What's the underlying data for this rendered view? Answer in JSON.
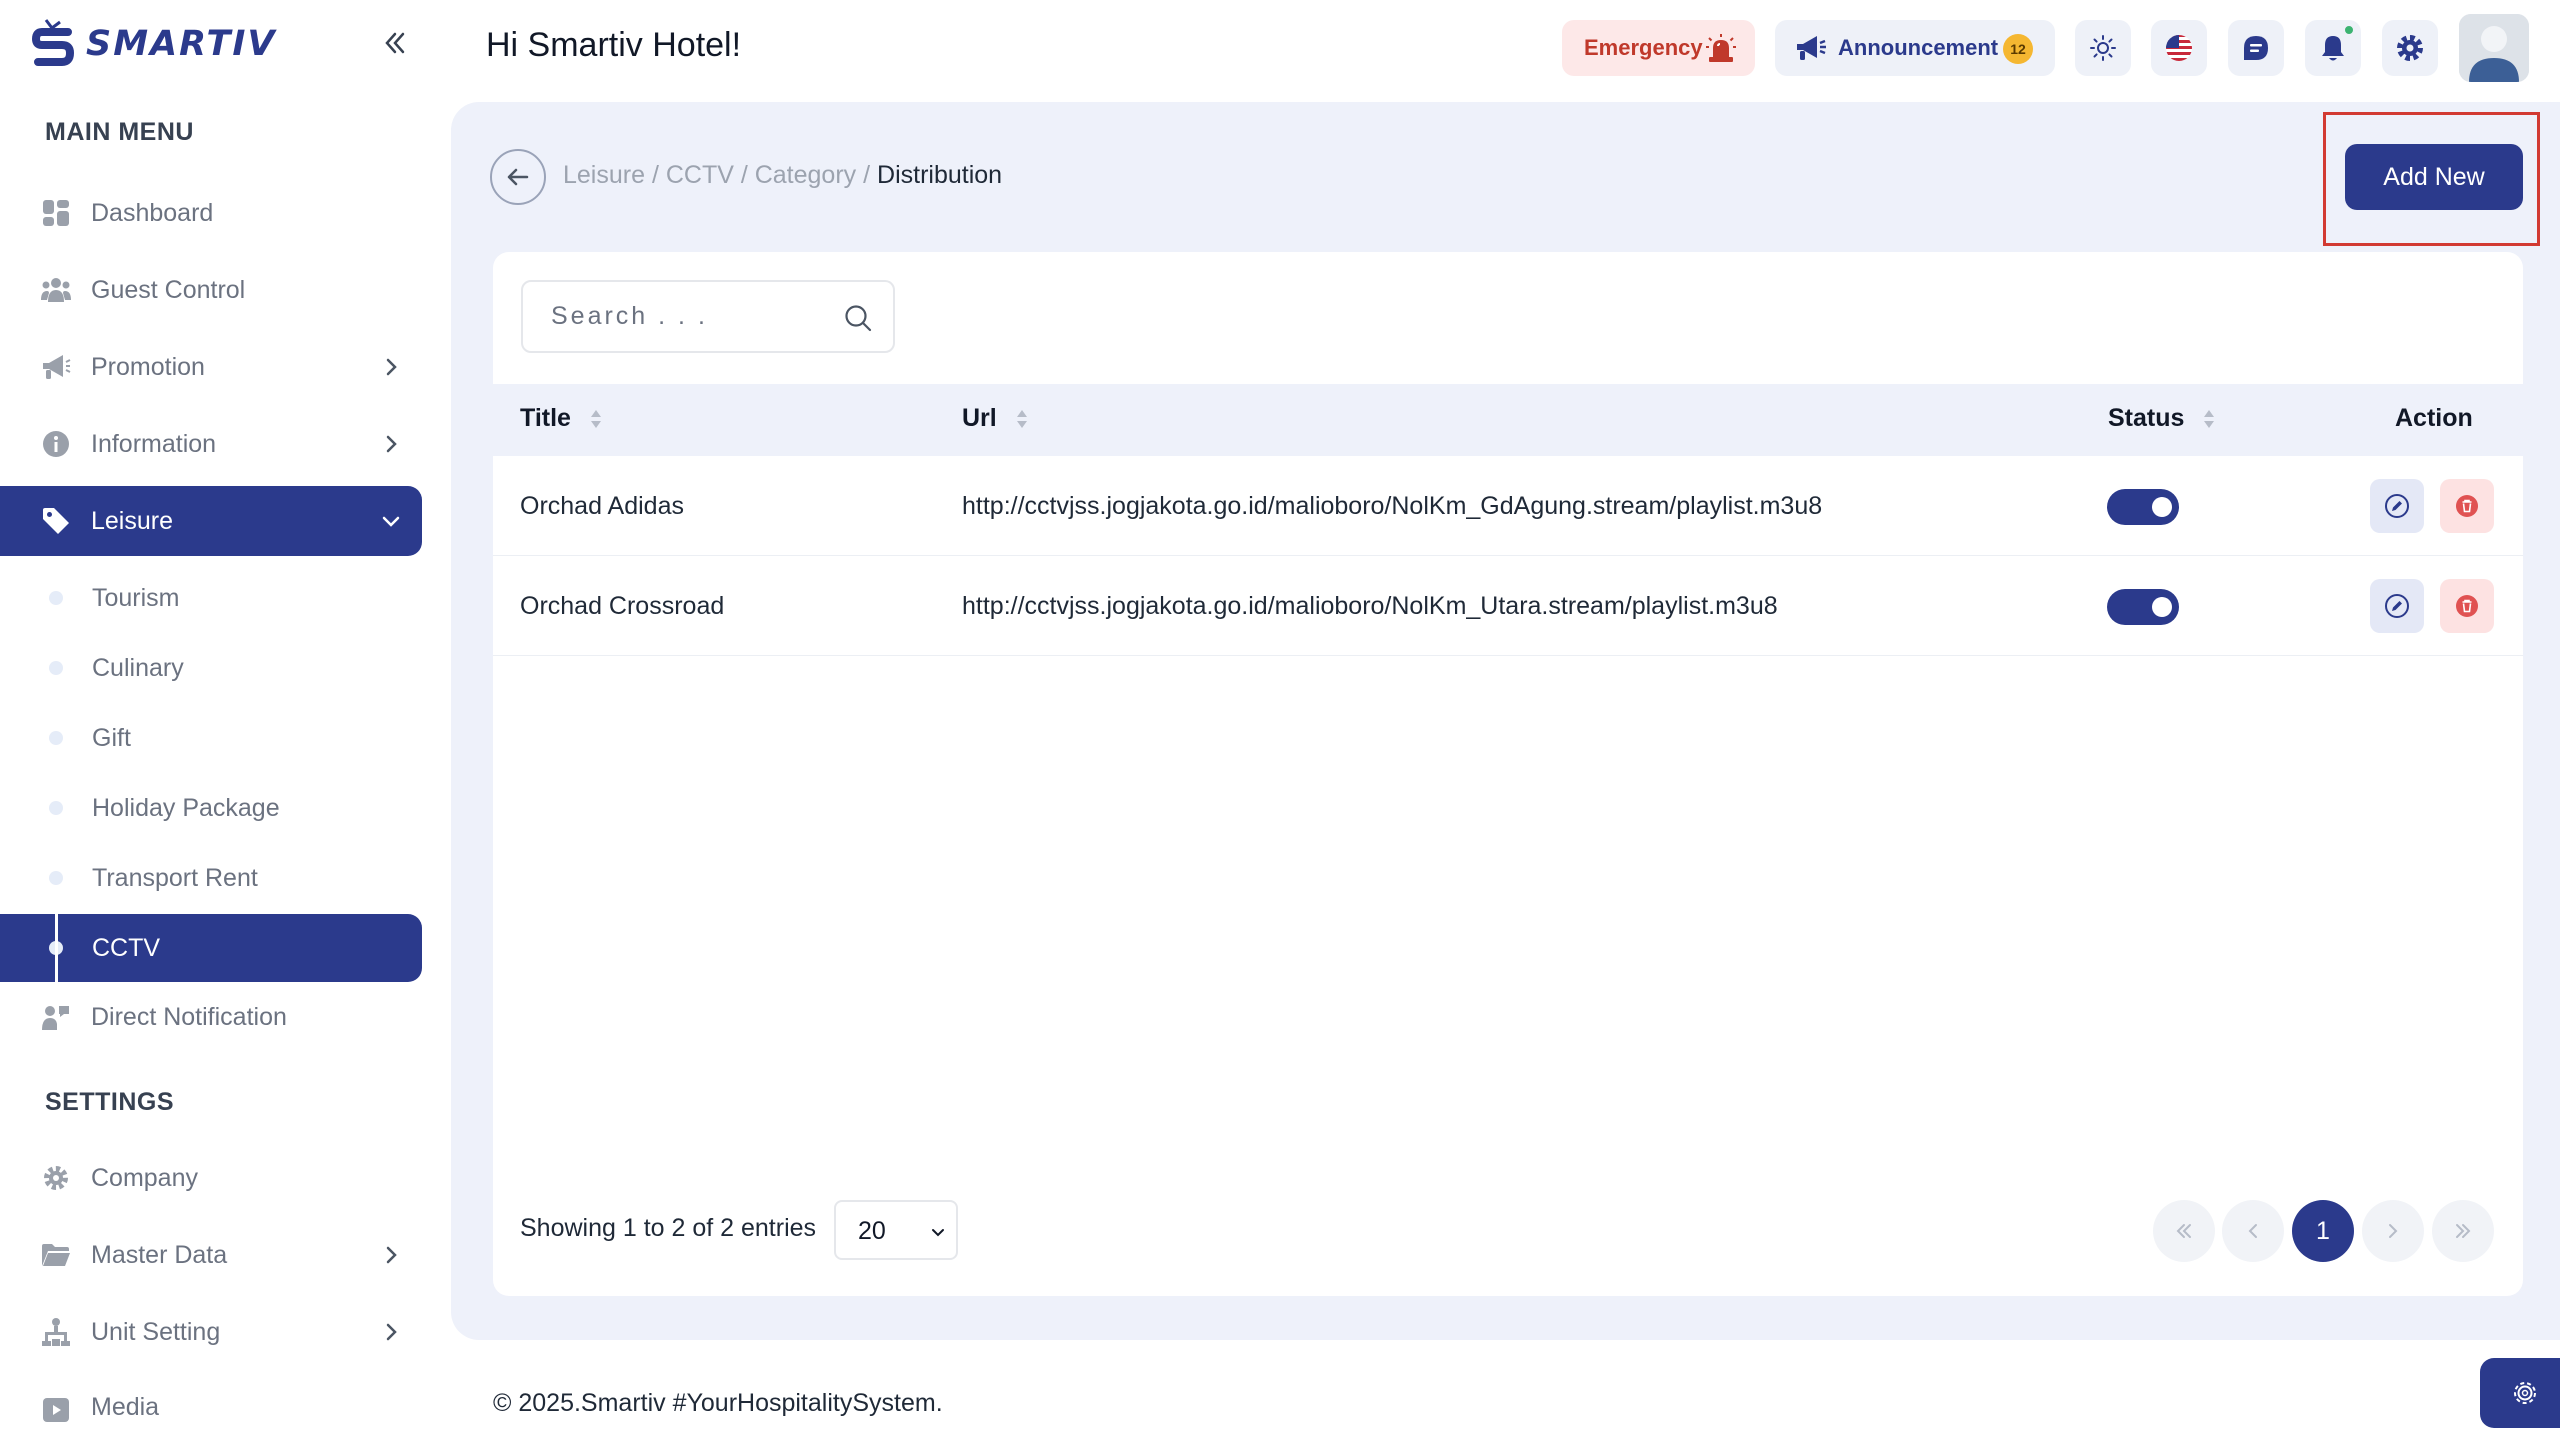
{
  "app": {
    "logo_text": "SMARTIV",
    "greeting": "Hi Smartiv Hotel!"
  },
  "sidebar": {
    "main_menu_title": "MAIN MENU",
    "settings_title": "SETTINGS",
    "items": [
      {
        "label": "Dashboard",
        "icon": "dashboard-icon"
      },
      {
        "label": "Guest Control",
        "icon": "users-icon"
      },
      {
        "label": "Promotion",
        "icon": "megaphone-icon"
      },
      {
        "label": "Information",
        "icon": "info-icon"
      },
      {
        "label": "Leisure",
        "icon": "tag-icon"
      },
      {
        "label": "Direct Notification",
        "icon": "notification-icon"
      }
    ],
    "leisure_sub": [
      "Tourism",
      "Culinary",
      "Gift",
      "Holiday Package",
      "Transport Rent",
      "CCTV"
    ],
    "settings_items": [
      {
        "label": "Company",
        "icon": "gear-icon"
      },
      {
        "label": "Master Data",
        "icon": "folder-icon"
      },
      {
        "label": "Unit Setting",
        "icon": "unit-icon"
      },
      {
        "label": "Media",
        "icon": "media-icon"
      }
    ]
  },
  "header": {
    "emergency_label": "Emergency",
    "announcement_label": "Announcement",
    "announcement_count": "12"
  },
  "breadcrumb": {
    "trail": "Leisure / CCTV / Category / ",
    "current": "Distribution"
  },
  "toolbar": {
    "add_new_label": "Add New"
  },
  "search": {
    "placeholder": "Search . . ."
  },
  "table": {
    "columns": [
      "Title",
      "Url",
      "Status",
      "Action"
    ],
    "rows": [
      {
        "title": "Orchad Adidas",
        "url": "http://cctvjss.jogjakota.go.id/malioboro/NolKm_GdAgung.stream/playlist.m3u8",
        "status": "on"
      },
      {
        "title": "Orchad Crossroad",
        "url": "http://cctvjss.jogjakota.go.id/malioboro/NolKm_Utara.stream/playlist.m3u8",
        "status": "on"
      }
    ]
  },
  "pagination": {
    "showing_text": "Showing 1 to 2 of 2 entries",
    "per_page": "20",
    "current_page": "1"
  },
  "footer": {
    "copyright": "© 2025.Smartiv #YourHospitalitySystem."
  },
  "colors": {
    "primary": "#2b3a8c",
    "panel_bg": "#eef1fa",
    "emergency_bg": "#fde8e8",
    "emergency_text": "#c0392b",
    "badge": "#f5b731",
    "highlight_box": "#d23a32"
  }
}
